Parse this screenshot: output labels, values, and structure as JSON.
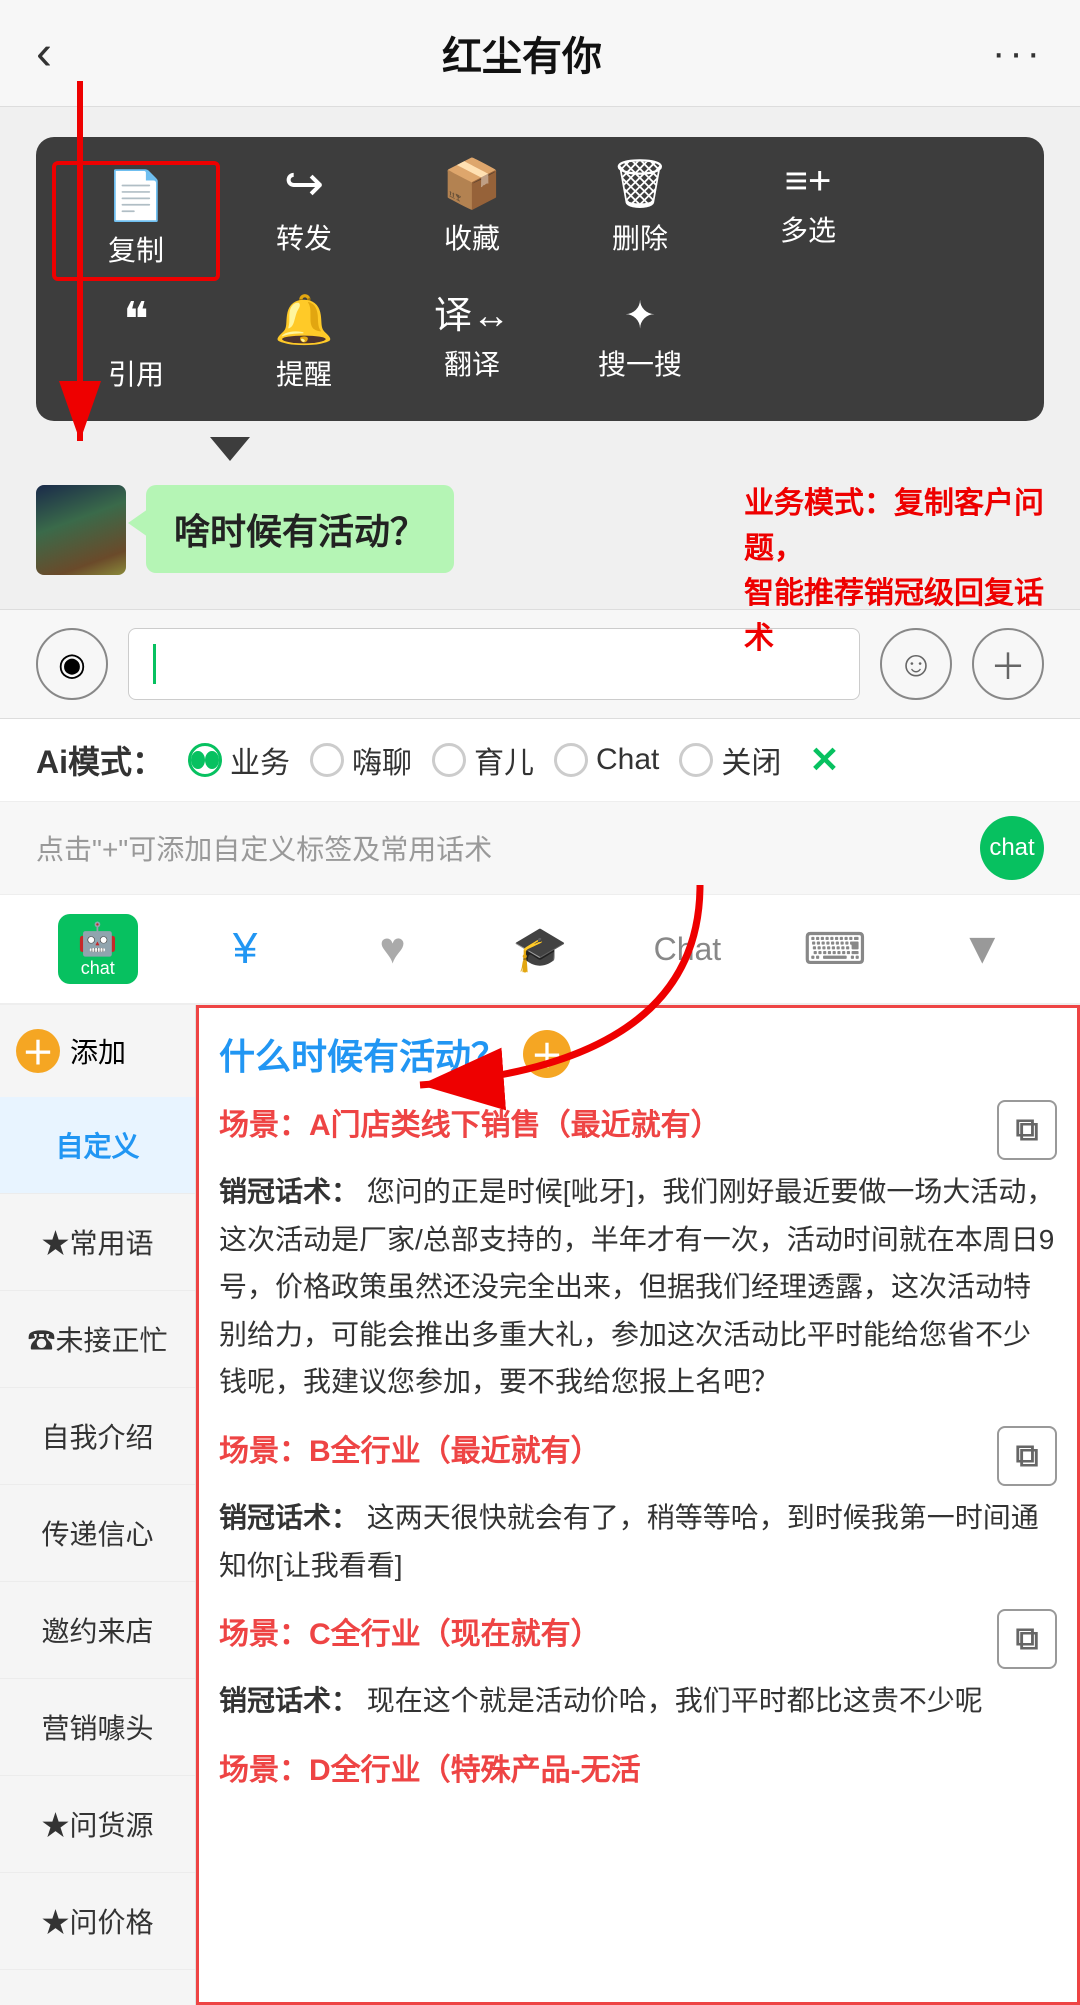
{
  "header": {
    "back_icon": "‹",
    "title": "红尘有你",
    "more_icon": "···"
  },
  "context_menu": {
    "row1": [
      {
        "icon": "📄",
        "label": "复制",
        "selected": true
      },
      {
        "icon": "↪",
        "label": "转发"
      },
      {
        "icon": "⬡",
        "label": "收藏"
      },
      {
        "icon": "🗑",
        "label": "删除"
      },
      {
        "icon": "☰",
        "label": "多选"
      }
    ],
    "row2": [
      {
        "icon": "❝",
        "label": "引用"
      },
      {
        "icon": "🔔",
        "label": "提醒"
      },
      {
        "icon": "⟲",
        "label": "翻译"
      },
      {
        "icon": "✦",
        "label": "搜一搜"
      }
    ]
  },
  "annotation": "业务模式：复制客户问题，\n智能推荐销冠级回复话术",
  "chat_message": "啥时候有活动？",
  "input_placeholder": "",
  "ai_modes": {
    "label": "Ai模式：",
    "options": [
      {
        "label": "业务",
        "active": true
      },
      {
        "label": "嗨聊",
        "active": false
      },
      {
        "label": "育儿",
        "active": false
      },
      {
        "label": "Chat",
        "active": false
      },
      {
        "label": "关闭",
        "active": false
      }
    ],
    "close_icon": "✕"
  },
  "hint_bar": {
    "text": "点击\"+\"可添加自定义标签及常用话术"
  },
  "toolbar": {
    "items": [
      {
        "icon": "chat",
        "label": "chat-icon",
        "active": true
      },
      {
        "icon": "¥",
        "label": "money-icon",
        "active": false
      },
      {
        "icon": "♥",
        "label": "heart-icon",
        "active": false
      },
      {
        "icon": "🎓",
        "label": "grad-icon",
        "active": false
      },
      {
        "icon": "Chat",
        "label": "chat-text",
        "active": false
      },
      {
        "icon": "⌨",
        "label": "keyboard-icon",
        "active": false
      },
      {
        "icon": "▼",
        "label": "dropdown-icon",
        "active": false
      }
    ]
  },
  "sidebar": {
    "add_label": "添加",
    "items": [
      {
        "label": "自定义",
        "active": true
      },
      {
        "label": "★常用语",
        "active": false
      },
      {
        "label": "☎未接正忙",
        "active": false
      },
      {
        "label": "自我介绍",
        "active": false
      },
      {
        "label": "传递信心",
        "active": false
      },
      {
        "label": "邀约来店",
        "active": false
      },
      {
        "label": "营销噱头",
        "active": false
      },
      {
        "label": "★问货源",
        "active": false
      },
      {
        "label": "★问价格",
        "active": false
      }
    ]
  },
  "right_panel": {
    "question": "什么时候有活动？",
    "scenes": [
      {
        "scene_title": "场景：A门店类线下销售（最近就有）",
        "sales_label": "销冠话术：",
        "sales_text": "您问的正是时候[呲牙]，我们刚好最近要做一场大活动，这次活动是厂家/总部支持的，半年才有一次，活动时间就在本周日9号，价格政策虽然还没完全出来，但据我们经理透露，这次活动特别给力，可能会推出多重大礼，参加这次活动比平时能给您省不少钱呢，我建议您参加，要不我给您报上名吧？"
      },
      {
        "scene_title": "场景：B全行业（最近就有）",
        "sales_label": "销冠话术：",
        "sales_text": "这两天很快就会有了，稍等等哈，到时候我第一时间通知你[让我看看]"
      },
      {
        "scene_title": "场景：C全行业（现在就有）",
        "sales_label": "销冠话术：",
        "sales_text": "现在这个就是活动价哈，我们平时都比这贵不少呢"
      },
      {
        "scene_title": "场景：D全行业（特殊产品-无活",
        "sales_label": "",
        "sales_text": ""
      }
    ]
  }
}
